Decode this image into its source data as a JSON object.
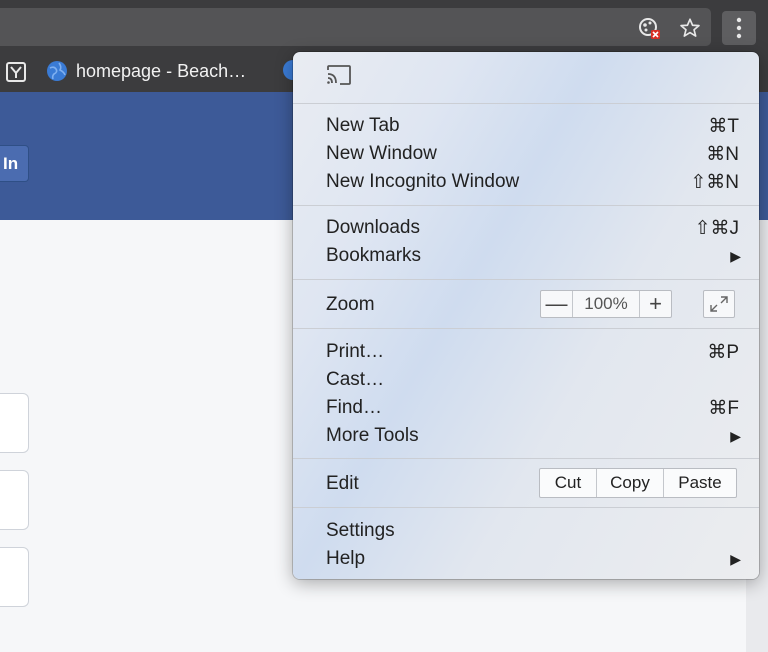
{
  "toolbar": {
    "extension_icon": "extension-blocked-icon",
    "star_icon": "bookmark-star-icon",
    "menu_icon": "three-dot-menu-icon"
  },
  "bookmarks": {
    "items": [
      {
        "icon": "app-icon"
      },
      {
        "label": "homepage - Beach…",
        "icon": "globe-icon"
      },
      {
        "icon": "globe-icon"
      }
    ]
  },
  "page": {
    "login_label": "In"
  },
  "menu": {
    "cast_icon": "cast-icon",
    "new_tab": {
      "label": "New Tab",
      "shortcut": "⌘T"
    },
    "new_window": {
      "label": "New Window",
      "shortcut": "⌘N"
    },
    "new_incognito": {
      "label": "New Incognito Window",
      "shortcut": "⇧⌘N"
    },
    "downloads": {
      "label": "Downloads",
      "shortcut": "⇧⌘J"
    },
    "bookmarks": {
      "label": "Bookmarks",
      "arrow": "▶"
    },
    "zoom": {
      "label": "Zoom",
      "minus": "—",
      "value": "100%",
      "plus": "+"
    },
    "print": {
      "label": "Print…",
      "shortcut": "⌘P"
    },
    "cast": {
      "label": "Cast…"
    },
    "find": {
      "label": "Find…",
      "shortcut": "⌘F"
    },
    "more_tools": {
      "label": "More Tools",
      "arrow": "▶"
    },
    "edit": {
      "label": "Edit",
      "cut": "Cut",
      "copy": "Copy",
      "paste": "Paste"
    },
    "settings": {
      "label": "Settings"
    },
    "help": {
      "label": "Help",
      "arrow": "▶"
    }
  }
}
